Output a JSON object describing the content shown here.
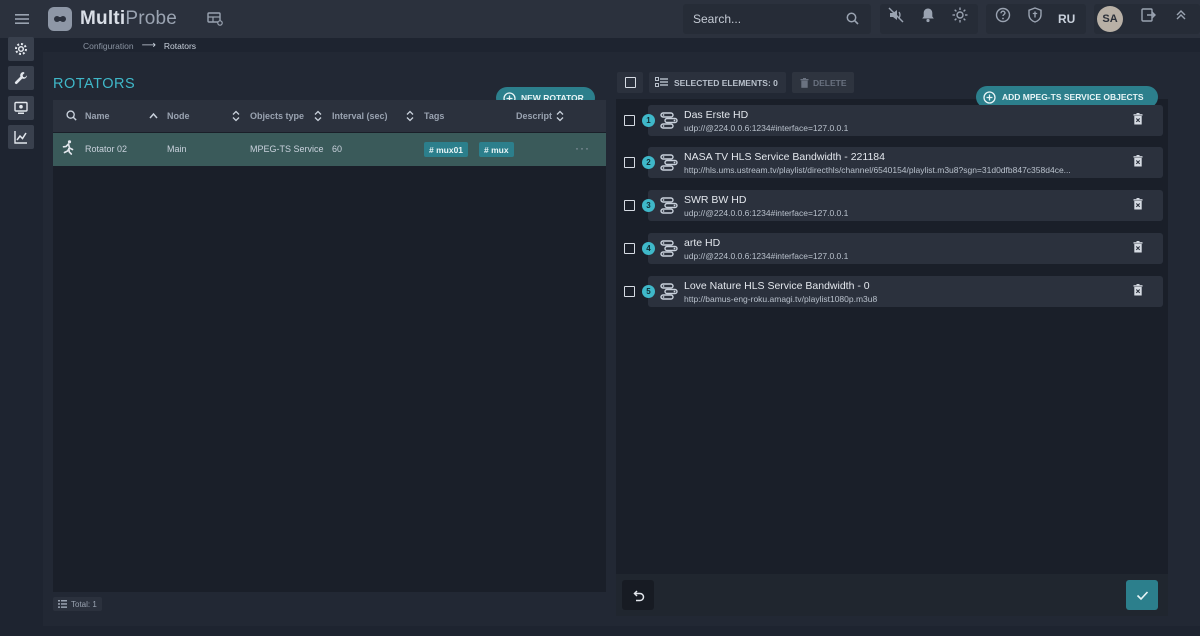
{
  "app": {
    "name_bold": "Multi",
    "name_light": "Probe"
  },
  "search": {
    "placeholder": "Search..."
  },
  "header": {
    "language": "RU",
    "user_initials": "SA"
  },
  "breadcrumb": {
    "items": [
      "Configuration",
      "Rotators"
    ],
    "separator": "⟶"
  },
  "page": {
    "title": "ROTATORS",
    "new_button": "NEW ROTATOR"
  },
  "table": {
    "columns": [
      "Name",
      "Node",
      "Objects type",
      "Interval (sec)",
      "Tags",
      "Descript"
    ],
    "rows": [
      {
        "name": "Rotator 02",
        "node": "Main",
        "objects_type": "MPEG-TS Service",
        "interval": "60",
        "tags": [
          "mux01",
          "mux"
        ],
        "more": "···"
      }
    ],
    "total_label": "Total: 1"
  },
  "right": {
    "selected_label": "SELECTED ELEMENTS: 0",
    "delete_label": "DELETE",
    "add_button": "ADD MPEG-TS SERVICE OBJECTS",
    "items": [
      {
        "num": "1",
        "title": "Das Erste HD",
        "url": "udp://@224.0.0.6:1234#interface=127.0.0.1"
      },
      {
        "num": "2",
        "title": "NASA TV HLS Service Bandwidth - 221184",
        "url": "http://hls.ums.ustream.tv/playlist/directhls/channel/6540154/playlist.m3u8?sgn=31d0dfb847c358d4ce..."
      },
      {
        "num": "3",
        "title": "SWR BW HD",
        "url": "udp://@224.0.0.6:1234#interface=127.0.0.1"
      },
      {
        "num": "4",
        "title": "arte HD",
        "url": "udp://@224.0.0.6:1234#interface=127.0.0.1"
      },
      {
        "num": "5",
        "title": "Love Nature HLS Service Bandwidth - 0",
        "url": "http://bamus-eng-roku.amagi.tv/playlist1080p.m3u8"
      }
    ]
  },
  "colors": {
    "accent": "#2c7f8c",
    "accent_text": "#3fb8c9",
    "selected_row": "#3a5a5a"
  }
}
